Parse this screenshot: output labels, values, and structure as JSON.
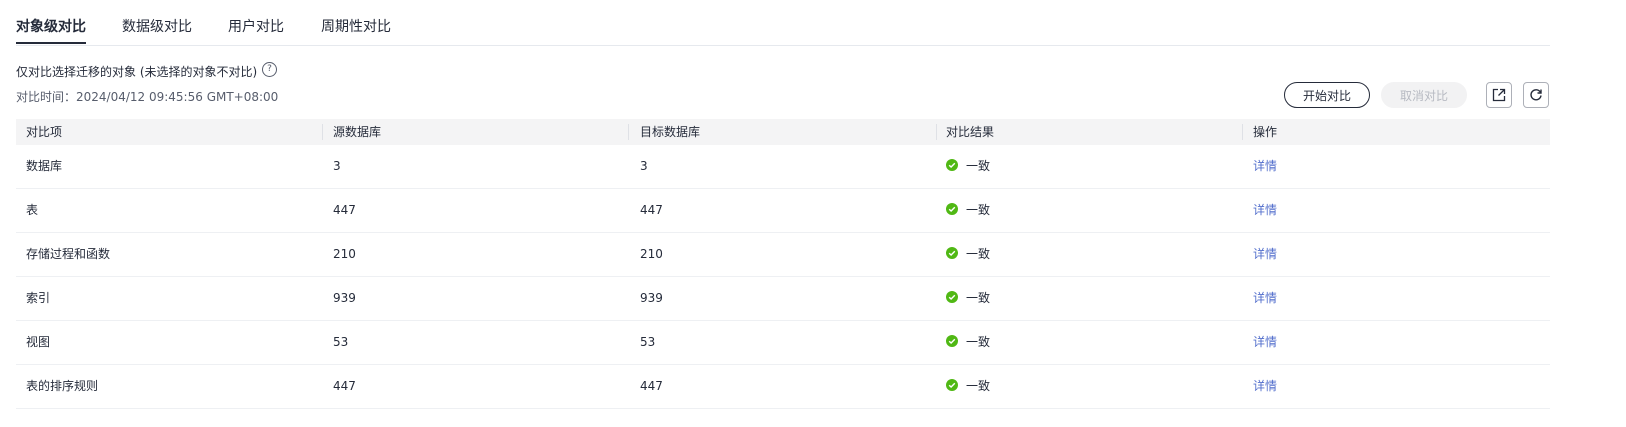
{
  "tabs": [
    {
      "label": "对象级对比",
      "active": true
    },
    {
      "label": "数据级对比",
      "active": false
    },
    {
      "label": "用户对比",
      "active": false
    },
    {
      "label": "周期性对比",
      "active": false
    }
  ],
  "note": "仅对比选择迁移的对象 (未选择的对象不对比)",
  "compare_time": "对比时间：2024/04/12 09:45:56 GMT+08:00",
  "buttons": {
    "start": "开始对比",
    "cancel": "取消对比"
  },
  "icons": {
    "export": "export-icon",
    "refresh": "refresh-icon",
    "ok": "check-circle-icon",
    "help": "question-circle-icon"
  },
  "colors": {
    "success": "#50b814",
    "link": "#526ecc"
  },
  "table": {
    "headers": [
      "对比项",
      "源数据库",
      "目标数据库",
      "对比结果",
      "操作"
    ],
    "rows": [
      {
        "item": "数据库",
        "source": "3",
        "target": "3",
        "result": "一致",
        "action": "详情"
      },
      {
        "item": "表",
        "source": "447",
        "target": "447",
        "result": "一致",
        "action": "详情"
      },
      {
        "item": "存储过程和函数",
        "source": "210",
        "target": "210",
        "result": "一致",
        "action": "详情"
      },
      {
        "item": "索引",
        "source": "939",
        "target": "939",
        "result": "一致",
        "action": "详情"
      },
      {
        "item": "视图",
        "source": "53",
        "target": "53",
        "result": "一致",
        "action": "详情"
      },
      {
        "item": "表的排序规则",
        "source": "447",
        "target": "447",
        "result": "一致",
        "action": "详情"
      }
    ]
  }
}
